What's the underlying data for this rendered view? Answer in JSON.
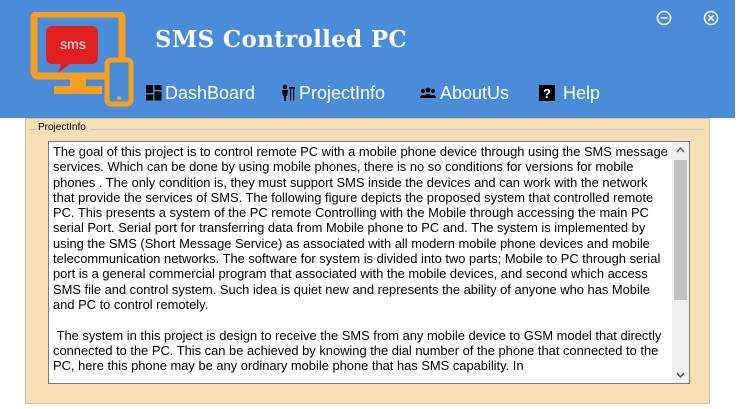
{
  "app": {
    "title": "SMS Controlled PC",
    "logo_badge": "sms"
  },
  "window_controls": {
    "minimize_icon": "minimize-circle-icon",
    "close_icon": "close-circle-icon"
  },
  "nav": {
    "items": [
      {
        "label": "DashBoard",
        "icon": "dashboard-icon"
      },
      {
        "label": "ProjectInfo",
        "icon": "project-info-icon"
      },
      {
        "label": "AboutUs",
        "icon": "users-icon"
      },
      {
        "label": "Help",
        "icon": "help-icon"
      }
    ]
  },
  "main": {
    "group_label": "ProjectInfo",
    "paragraphs": [
      "The goal of this project is to control remote PC with a mobile phone device through using the SMS message services. Which can be done by using mobile phones, there is no so conditions for versions for mobile phones . The only condition is, they must support SMS inside the devices and can work with the network that provide the services of SMS. The following figure depicts the proposed system that controlled remote PC. This presents a system of the PC remote Controlling with the Mobile  through accessing the main PC serial Port. Serial port for transferring data from Mobile phone to PC and. The system is implemented by using the SMS (Short Message Service) as associated with all modern mobile phone devices and mobile telecommunication networks. The software for system is divided into two parts; Mobile to PC through serial port is a general commercial program that associated with the mobile devices, and second which access SMS file and control system. Such idea is quiet new and represents the ability of anyone who has Mobile and PC to control remotely.",
      " The system in this project is design to receive the SMS from any mobile device to GSM model that directly connected to the PC. This can be achieved by knowing the dial number of the phone that connected to the PC, here this phone may be any ordinary mobile phone that has SMS capability. In"
    ]
  },
  "colors": {
    "header_bg": "#4a8cd8",
    "logo_orange": "#f5a020",
    "logo_red": "#e02020",
    "panel_bg": "#f6deb5"
  }
}
